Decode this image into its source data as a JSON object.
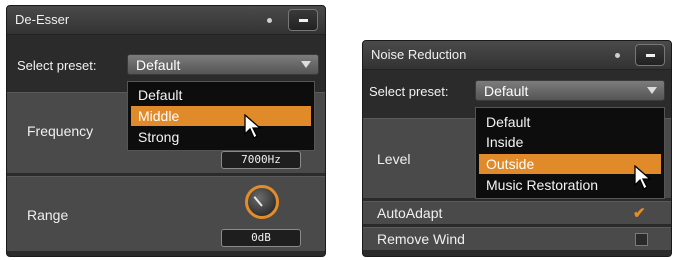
{
  "deesser": {
    "title": "De-Esser",
    "preset_label": "Select preset:",
    "preset_value": "Default",
    "options": [
      "Default",
      "Middle",
      "Strong"
    ],
    "selected_option": "Middle",
    "frequency_label": "Frequency",
    "frequency_value": "7000Hz",
    "range_label": "Range",
    "range_value": "0dB"
  },
  "noise_reduction": {
    "title": "Noise Reduction",
    "preset_label": "Select preset:",
    "preset_value": "Default",
    "options": [
      "Default",
      "Inside",
      "Outside",
      "Music Restoration"
    ],
    "selected_option": "Outside",
    "level_label": "Level",
    "autoadapt_label": "AutoAdapt",
    "autoadapt_checked": true,
    "remove_wind_label": "Remove Wind",
    "remove_wind_checked": false
  },
  "colors": {
    "accent": "#e08a2a",
    "panel_bg": "#2b2b2b",
    "section_bg": "#4a4a4a"
  }
}
